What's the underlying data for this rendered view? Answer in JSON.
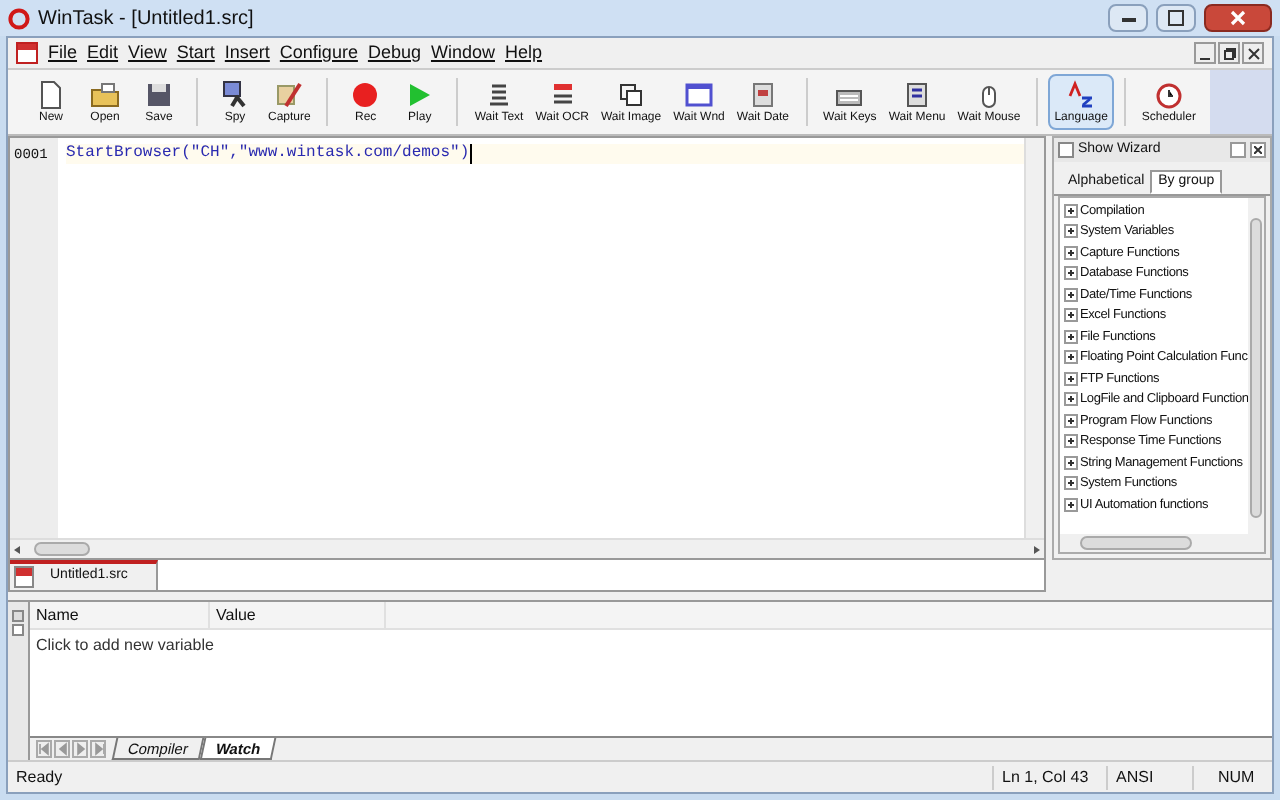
{
  "window": {
    "title": "WinTask - [Untitled1.src]"
  },
  "menu": [
    "File",
    "Edit",
    "View",
    "Start",
    "Insert",
    "Configure",
    "Debug",
    "Window",
    "Help"
  ],
  "toolbar": [
    {
      "label": "New",
      "selected": false
    },
    {
      "label": "Open",
      "selected": false
    },
    {
      "label": "Save",
      "selected": false
    },
    {
      "label": "Spy",
      "selected": false
    },
    {
      "label": "Capture",
      "selected": false
    },
    {
      "label": "Rec",
      "selected": false
    },
    {
      "label": "Play",
      "selected": false
    },
    {
      "label": "Wait Text",
      "selected": false
    },
    {
      "label": "Wait OCR",
      "selected": false
    },
    {
      "label": "Wait Image",
      "selected": false
    },
    {
      "label": "Wait Wnd",
      "selected": false
    },
    {
      "label": "Wait Date",
      "selected": false
    },
    {
      "label": "Wait Keys",
      "selected": false
    },
    {
      "label": "Wait Menu",
      "selected": false
    },
    {
      "label": "Wait Mouse",
      "selected": false
    },
    {
      "label": "Language",
      "selected": true
    },
    {
      "label": "Scheduler",
      "selected": false
    }
  ],
  "editor": {
    "lines": [
      {
        "number": "0001",
        "code": "StartBrowser(\"CH\",\"www.wintask.com/demos\")"
      }
    ]
  },
  "document_tab": {
    "label": "Untitled1.src"
  },
  "wizard": {
    "show_wizard": {
      "label": "Show Wizard",
      "checked": false
    },
    "tabs": [
      {
        "label": "Alphabetical",
        "selected": false
      },
      {
        "label": "By group",
        "selected": true
      }
    ],
    "items": [
      {
        "label": "Compilation",
        "expanded": false
      },
      {
        "label": "System Variables",
        "expanded": false
      },
      {
        "label": "Capture Functions",
        "expanded": false
      },
      {
        "label": "Database Functions",
        "expanded": false
      },
      {
        "label": "Date/Time Functions",
        "expanded": false
      },
      {
        "label": "Excel Functions",
        "expanded": false
      },
      {
        "label": "File Functions",
        "expanded": false
      },
      {
        "label": "Floating Point Calculation Func",
        "expanded": false
      },
      {
        "label": "FTP Functions",
        "expanded": false
      },
      {
        "label": "LogFile and Clipboard Function",
        "expanded": false
      },
      {
        "label": "Program Flow Functions",
        "expanded": false
      },
      {
        "label": "Response Time Functions",
        "expanded": false
      },
      {
        "label": "String Management Functions",
        "expanded": false
      },
      {
        "label": "System Functions",
        "expanded": false
      },
      {
        "label": "UI Automation functions",
        "expanded": false
      }
    ]
  },
  "watch": {
    "columns": [
      "Name",
      "Value"
    ],
    "placeholder_row": "Click to add new variable",
    "tabs": [
      {
        "label": "Compiler",
        "selected": false
      },
      {
        "label": "Watch",
        "selected": true
      }
    ]
  },
  "status_bar": {
    "message": "Ready",
    "position": "Ln 1, Col 43",
    "encoding": "ANSI",
    "num": "NUM"
  }
}
